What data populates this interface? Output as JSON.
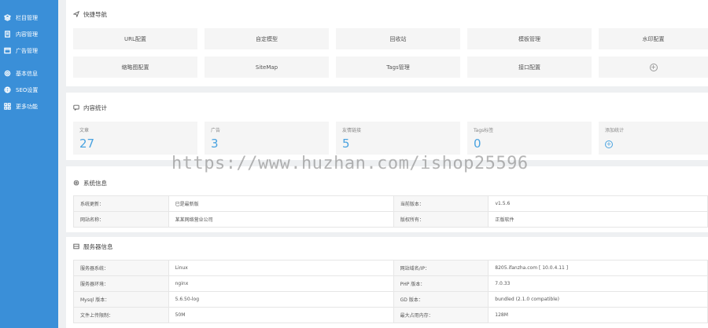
{
  "sidebar": {
    "groups": [
      [
        {
          "label": "栏目管理",
          "icon": "layers-icon"
        },
        {
          "label": "内容管理",
          "icon": "document-icon"
        },
        {
          "label": "广告管理",
          "icon": "ad-icon"
        }
      ],
      [
        {
          "label": "基本信息",
          "icon": "gear-icon"
        },
        {
          "label": "SEO设置",
          "icon": "globe-icon"
        },
        {
          "label": "更多功能",
          "icon": "grid-icon"
        }
      ]
    ]
  },
  "quick_nav": {
    "title": "快捷导航",
    "buttons": [
      "URL配置",
      "自定模型",
      "回收站",
      "模板管理",
      "水印配置",
      "缩略图配置",
      "SiteMap",
      "Tags管理",
      "接口配置"
    ]
  },
  "stats": {
    "title": "内容统计",
    "items": [
      {
        "label": "文章",
        "value": "27"
      },
      {
        "label": "广告",
        "value": "3"
      },
      {
        "label": "友情链接",
        "value": "5"
      },
      {
        "label": "Tags标签",
        "value": "0"
      },
      {
        "label": "添加统计"
      }
    ]
  },
  "system_info": {
    "title": "系统信息",
    "rows": [
      [
        "系统更新：",
        "已是最新版",
        "当前版本：",
        "v1.5.6"
      ],
      [
        "网站名称：",
        "某某网络营业公司",
        "版权所有：",
        "正版软件"
      ]
    ]
  },
  "server_info": {
    "title": "服务器信息",
    "rows": [
      [
        "服务器系统：",
        "Linux",
        "网站域名/IP：",
        "8205.ifanzha.com [ 10.0.4.11 ]"
      ],
      [
        "服务器环境：",
        "nginx",
        "PHP 版本：",
        "7.0.33"
      ],
      [
        "Mysql 版本：",
        "5.6.50-log",
        "GD 版本：",
        "bundled (2.1.0 compatible)"
      ],
      [
        "文件上传限制：",
        "50M",
        "最大占用内存：",
        "128M"
      ]
    ]
  },
  "watermark": "https://www.huzhan.com/ishop25596",
  "colors": {
    "sidebar": "#3a8fd8",
    "accent": "#4aa3e0"
  }
}
